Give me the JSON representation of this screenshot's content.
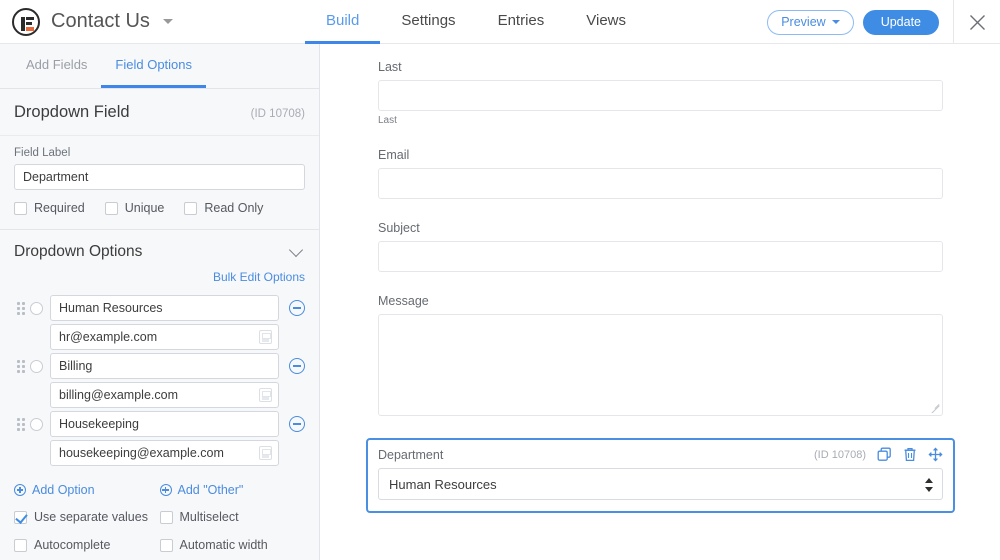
{
  "topbar": {
    "logo_icon": "wpforms-logo-icon",
    "form_title": "Contact Us",
    "title_caret_icon": "caret-down-icon",
    "tabs": [
      {
        "label": "Build",
        "active": true
      },
      {
        "label": "Settings",
        "active": false
      },
      {
        "label": "Entries",
        "active": false
      },
      {
        "label": "Views",
        "active": false
      }
    ],
    "preview_label": "Preview",
    "preview_caret_icon": "caret-down-icon",
    "update_label": "Update",
    "close_icon": "close-icon"
  },
  "sidebar": {
    "tabs": [
      {
        "label": "Add Fields",
        "active": false
      },
      {
        "label": "Field Options",
        "active": true
      }
    ],
    "field_title": "Dropdown Field",
    "field_id": "(ID 10708)",
    "field_label_caption": "Field Label",
    "field_label_value": "Department",
    "field_label_placeholder": "",
    "flags": [
      {
        "label": "Required",
        "checked": false
      },
      {
        "label": "Unique",
        "checked": false
      },
      {
        "label": "Read Only",
        "checked": false
      }
    ],
    "options_section": {
      "title": "Dropdown Options",
      "collapse_icon": "chevron-down-icon",
      "bulk_edit_label": "Bulk Edit Options",
      "options": [
        {
          "drag_icon": "drag-handle-icon",
          "selected": false,
          "label": "Human Resources",
          "value": "hr@example.com",
          "image_icon": "image-upload-icon",
          "remove_icon": "minus-circle-icon"
        },
        {
          "drag_icon": "drag-handle-icon",
          "selected": false,
          "label": "Billing",
          "value": "billing@example.com",
          "image_icon": "image-upload-icon",
          "remove_icon": "minus-circle-icon"
        },
        {
          "drag_icon": "drag-handle-icon",
          "selected": false,
          "label": "Housekeeping",
          "value": "housekeeping@example.com",
          "image_icon": "image-upload-icon",
          "remove_icon": "minus-circle-icon"
        }
      ],
      "add_option_label": "Add Option",
      "add_other_label": "Add \"Other\"",
      "add_icon": "plus-circle-icon",
      "toggles": [
        {
          "label": "Use separate values",
          "checked": true
        },
        {
          "label": "Multiselect",
          "checked": false
        },
        {
          "label": "Autocomplete",
          "checked": false
        },
        {
          "label": "Automatic width",
          "checked": false
        }
      ]
    }
  },
  "preview": {
    "fields": [
      {
        "label": "Last",
        "type": "text",
        "sublabel": "Last"
      },
      {
        "label": "Email",
        "type": "text",
        "sublabel": ""
      },
      {
        "label": "Subject",
        "type": "text",
        "sublabel": ""
      },
      {
        "label": "Message",
        "type": "textarea",
        "sublabel": ""
      }
    ],
    "selected_field": {
      "label": "Department",
      "id": "(ID 10708)",
      "value": "Human Resources",
      "duplicate_icon": "duplicate-icon",
      "delete_icon": "trash-icon",
      "move_icon": "move-arrows-icon",
      "spinner_icon": "select-arrows-icon"
    }
  },
  "colors": {
    "accent_blue": "#3e8ce4",
    "link_blue": "#4a8ce0",
    "selected_border": "#4a90e2",
    "logo_orange": "#e8683a",
    "sidebar_bg": "#f7f8fa"
  }
}
